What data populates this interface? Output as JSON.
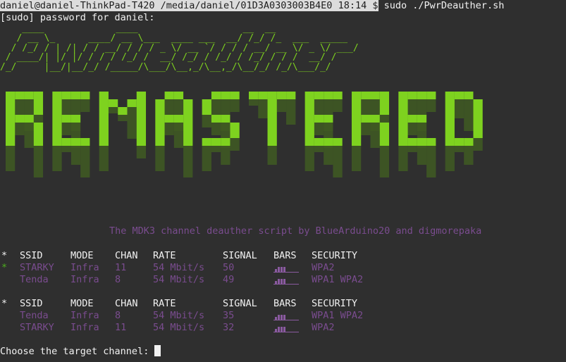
{
  "terminal": {
    "prompt_user_host": "daniel@daniel-ThinkPad-T420",
    "prompt_path": "/media/daniel/01D3A0303003B4E0",
    "prompt_time": "18:14",
    "prompt_symbol": "$",
    "command": "sudo ./PwrDeauther.sh",
    "sudo_prompt": "[sudo] password for daniel:"
  },
  "banner": {
    "ascii_logo_text": "PwrDeauther",
    "big_logo_text": "REMASTERED",
    "logo_color": "#7ed21f",
    "tagline": "The MDK3 channel deauther script by BlueArduino20 and digmorepaka"
  },
  "scan_tables": [
    {
      "headers": {
        "star": "*",
        "ssid": "SSID",
        "mode": "MODE",
        "chan": "CHAN",
        "rate": "RATE",
        "signal": "SIGNAL",
        "bars": "BARS",
        "security": "SECURITY"
      },
      "rows": [
        {
          "marker": "*",
          "ssid": "STARKY",
          "mode": "Infra",
          "chan": "11",
          "rate": "54 Mbit/s",
          "signal": "50",
          "bars_level": 2,
          "security": "WPA2"
        },
        {
          "marker": "",
          "ssid": "Tenda",
          "mode": "Infra",
          "chan": "8",
          "rate": "54 Mbit/s",
          "signal": "49",
          "bars_level": 2,
          "security": "WPA1 WPA2"
        }
      ]
    },
    {
      "headers": {
        "star": "*",
        "ssid": "SSID",
        "mode": "MODE",
        "chan": "CHAN",
        "rate": "RATE",
        "signal": "SIGNAL",
        "bars": "BARS",
        "security": "SECURITY"
      },
      "rows": [
        {
          "marker": "",
          "ssid": "Tenda",
          "mode": "Infra",
          "chan": "8",
          "rate": "54 Mbit/s",
          "signal": "35",
          "bars_level": 2,
          "security": "WPA1 WPA2"
        },
        {
          "marker": "",
          "ssid": "STARKY",
          "mode": "Infra",
          "chan": "11",
          "rate": "54 Mbit/s",
          "signal": "32",
          "bars_level": 2,
          "security": "WPA2"
        }
      ]
    }
  ],
  "input": {
    "prompt": "Choose the target channel:",
    "value": ""
  },
  "colors": {
    "background": "#2f2f2f",
    "text": "#f2f2f2",
    "dim_purple": "#7a4c8f",
    "green": "#7ed21f"
  }
}
